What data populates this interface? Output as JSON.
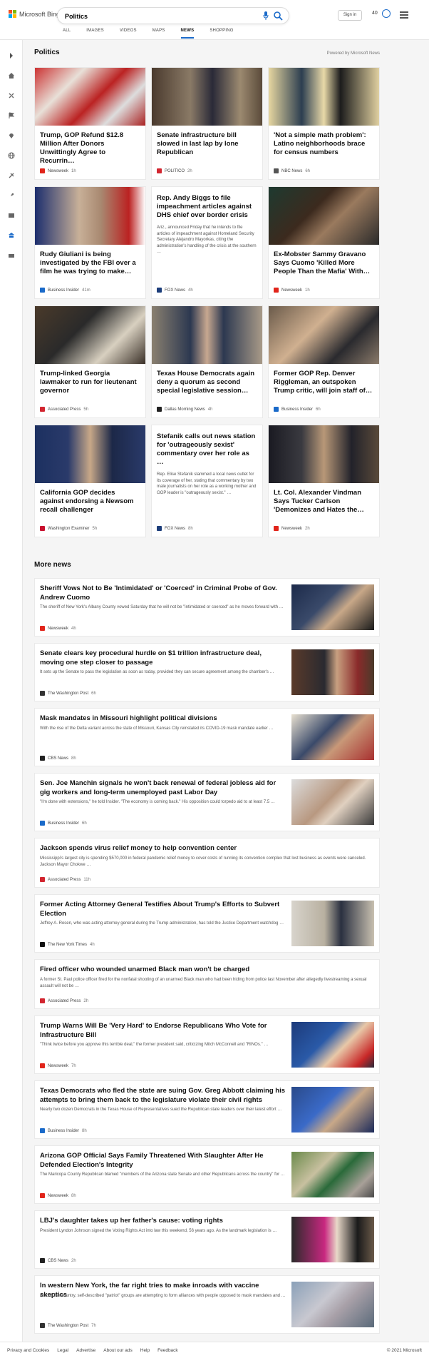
{
  "brand": {
    "name": "Microsoft Bing"
  },
  "search": {
    "query": "Politics"
  },
  "nav": [
    "ALL",
    "IMAGES",
    "VIDEOS",
    "MAPS",
    "NEWS",
    "SHOPPING"
  ],
  "header": {
    "signin": "Sign in",
    "rewards": "40"
  },
  "section": {
    "title": "Politics",
    "powered": "Powered by Microsoft News"
  },
  "cards": [
    {
      "title": "Trump, GOP Refund $12.8 Million After Donors Unwittingly Agree to Recurrin…",
      "source": "Newsweek",
      "age": "1h",
      "src_color": "#e1251b"
    },
    {
      "title": "Senate infrastructure bill slowed in last lap by lone Republican",
      "source": "POLITICO",
      "age": "2h",
      "src_color": "#d22630"
    },
    {
      "title": "'Not a simple math problem': Latino neighborhoods brace for census numbers",
      "source": "NBC News",
      "age": "6h",
      "src_color": "#555555"
    },
    {
      "title": "Rudy Giuliani is being investigated by the FBI over a film he was trying to make…",
      "source": "Business Insider",
      "age": "41m",
      "src_color": "#1a6ac9"
    },
    {
      "title": "Rep. Andy Biggs to file impeachment articles against DHS chief over border crisis",
      "desc": "Ariz., announced Friday that he intends to file articles of impeachment against Homeland Security Secretary Alejandro Mayorkas, citing the administration's handling of the crisis at the southern …",
      "source": "FOX News",
      "age": "4h",
      "src_color": "#1c3d7a"
    },
    {
      "title": "Ex-Mobster Sammy Gravano Says Cuomo 'Killed More People Than the Mafia' With…",
      "source": "Newsweek",
      "age": "1h",
      "src_color": "#e1251b"
    },
    {
      "title": "Trump-linked Georgia lawmaker to run for lieutenant governor",
      "source": "Associated Press",
      "age": "5h",
      "src_color": "#d22630"
    },
    {
      "title": "Texas House Democrats again deny a quorum as second special legislative session…",
      "source": "Dallas Morning News",
      "age": "4h",
      "src_color": "#222222"
    },
    {
      "title": "Former GOP Rep. Denver Riggleman, an outspoken Trump critic, will join staff of…",
      "source": "Business Insider",
      "age": "6h",
      "src_color": "#1a6ac9"
    },
    {
      "title": "California GOP decides against endorsing a Newsom recall challenger",
      "source": "Washington Examiner",
      "age": "5h",
      "src_color": "#c8102e"
    },
    {
      "title": "Stefanik calls out news station for 'outrageously sexist' commentary over her role as …",
      "desc": "Rep. Elise Stefanik slammed a local news outlet for its coverage of her, stating that commentary by two male journalists on her role as a working mother and GOP leader is \"outrageously sexist.\" …",
      "source": "FOX News",
      "age": "8h",
      "src_color": "#1c3d7a"
    },
    {
      "title": "Lt. Col. Alexander Vindman Says Tucker Carlson 'Demonizes and Hates the…",
      "source": "Newsweek",
      "age": "2h",
      "src_color": "#e1251b"
    }
  ],
  "more_title": "More news",
  "more": [
    {
      "title": "Sheriff Vows Not to Be 'Intimidated' or 'Coerced' in Criminal Probe of Gov. Andrew Cuomo",
      "desc": "The sheriff of New York's Albany County vowed Saturday that he will not be \"intimidated or coerced\" as he moves forward with …",
      "source": "Newsweek",
      "age": "4h",
      "src_color": "#e1251b",
      "thumb": true
    },
    {
      "title": "Senate clears key procedural hurdle on $1 trillion infrastructure deal, moving one step closer to passage",
      "desc": "It sets up the Senate to pass the legislation as soon as today, provided they can secure agreement among the chamber's …",
      "source": "The Washington Post",
      "age": "6h",
      "src_color": "#333333",
      "thumb": true
    },
    {
      "title": "Mask mandates in Missouri highlight political divisions",
      "desc": "With the rise of the Delta variant across the state of Missouri, Kansas City reinstated its COVID-19 mask mandate earlier …",
      "source": "CBS News",
      "age": "8h",
      "src_color": "#222222",
      "thumb": true
    },
    {
      "title": "Sen. Joe Manchin signals he won't back renewal of federal jobless aid for gig workers and long-term unemployed past Labor Day",
      "desc": "\"I'm done with extensions,\" he told Insider. \"The economy is coming back.\" His opposition could torpedo aid to at least 7.5 …",
      "source": "Business Insider",
      "age": "6h",
      "src_color": "#1a6ac9",
      "thumb": true
    },
    {
      "title": "Jackson spends virus relief money to help convention center",
      "desc": "Mississippi's largest city is spending $570,000 in federal pandemic relief money to cover costs of running its convention complex that lost business as events were canceled. Jackson Mayor Chokwe …",
      "source": "Associated Press",
      "age": "11h",
      "src_color": "#d22630",
      "thumb": false
    },
    {
      "title": "Former Acting Attorney General Testifies About Trump's Efforts to Subvert Election",
      "desc": "Jeffrey A. Rosen, who was acting attorney general during the Trump administration, has told the Justice Department watchdog …",
      "source": "The New York Times",
      "age": "4h",
      "src_color": "#111111",
      "thumb": true
    },
    {
      "title": "Fired officer who wounded unarmed Black man won't be charged",
      "desc": "A former St. Paul police officer fired for the nonfatal shooting of an unarmed Black man who had been hiding from police last November after allegedly livestreaming a sexual assault will not be …",
      "source": "Associated Press",
      "age": "2h",
      "src_color": "#d22630",
      "thumb": false
    },
    {
      "title": "Trump Warns Will Be 'Very Hard' to Endorse Republicans Who Vote for Infrastructure Bill",
      "desc": "\"Think twice before you approve this terrible deal,\" the former president said, criticizing Mitch McConnell and \"RINOs.\" …",
      "source": "Newsweek",
      "age": "7h",
      "src_color": "#e1251b",
      "thumb": true
    },
    {
      "title": "Texas Democrats who fled the state are suing Gov. Greg Abbott claiming his attempts to bring them back to the legislature violate their civil rights",
      "desc": "Nearly two dozen Democrats in the Texas House of Representatives sued the Republican state leaders over their latest effort …",
      "source": "Business Insider",
      "age": "8h",
      "src_color": "#1a6ac9",
      "thumb": true
    },
    {
      "title": "Arizona GOP Official Says Family Threatened With Slaughter After He Defended Election's Integrity",
      "desc": "The Maricopa County Republican blamed \"members of the Arizona state Senate and other Republicans across the country\" for …",
      "source": "Newsweek",
      "age": "8h",
      "src_color": "#e1251b",
      "thumb": true
    },
    {
      "title": "LBJ's daughter takes up her father's cause: voting rights",
      "desc": "President Lyndon Johnson signed the Voting Rights Act into law this weekend, 56 years ago. As the landmark legislation is …",
      "source": "CBS News",
      "age": "2h",
      "src_color": "#222222",
      "thumb": true
    },
    {
      "title": "In western New York, the far right tries to make inroads with vaccine skeptics",
      "desc": "Across the country, self-described \"patriot\" groups are attempting to form alliances with people opposed to mask mandates and …",
      "source": "The Washington Post",
      "age": "7h",
      "src_color": "#333333",
      "thumb": true
    }
  ],
  "footer": {
    "links": [
      "Privacy and Cookies",
      "Legal",
      "Advertise",
      "About our ads",
      "Help",
      "Feedback"
    ],
    "copyright": "© 2021 Microsoft"
  }
}
